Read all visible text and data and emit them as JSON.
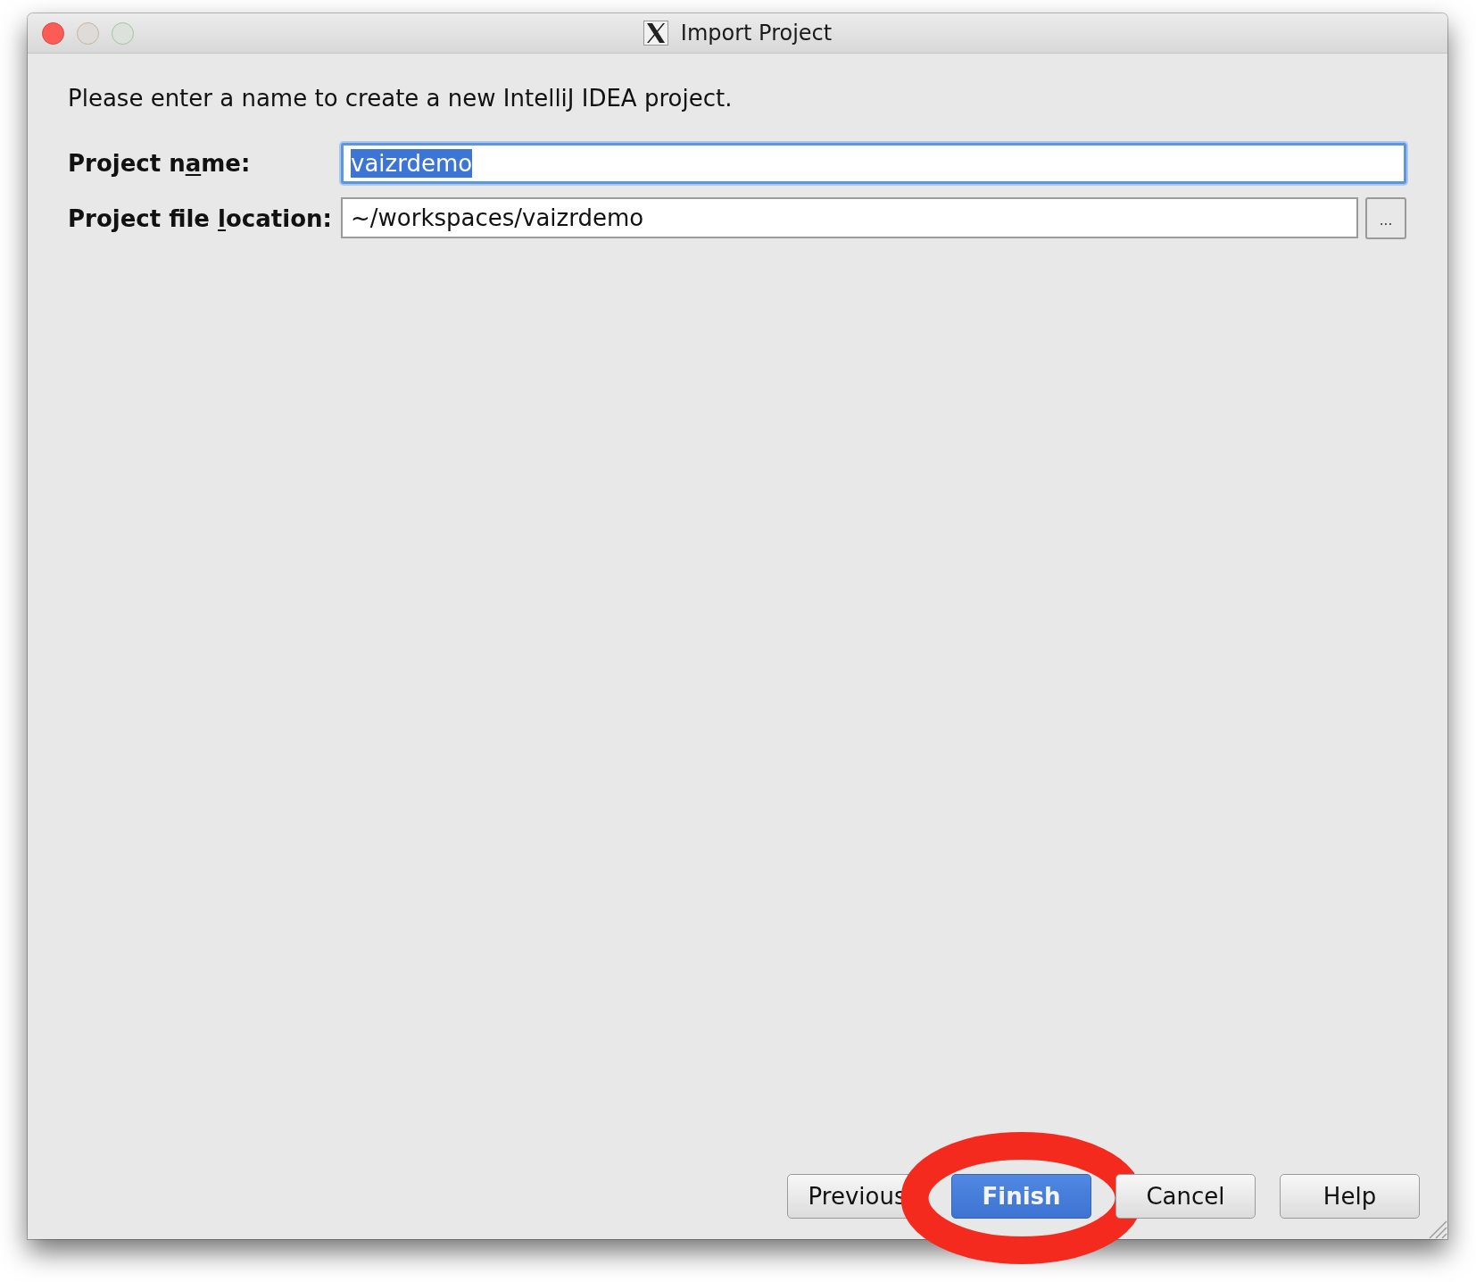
{
  "window": {
    "title": "Import Project",
    "controls": [
      {
        "kind": "close",
        "enabled": true
      },
      {
        "kind": "minimize",
        "enabled": false
      },
      {
        "kind": "zoom",
        "enabled": false
      }
    ]
  },
  "instruction": "Please enter a name to create a new IntelliJ IDEA project.",
  "fields": [
    {
      "label": {
        "before": "Project n",
        "mnemonic": "a",
        "after": "me:"
      },
      "value": "vaizrdemo",
      "focused": true,
      "text_selected": true
    },
    {
      "label": {
        "before": "Project file ",
        "mnemonic": "l",
        "after": "ocation:"
      },
      "value": "~/workspaces/vaizrdemo",
      "focused": false,
      "text_selected": false,
      "browse_button": "..."
    }
  ],
  "buttons": [
    {
      "label": "Previous",
      "default": false,
      "highlighted": false
    },
    {
      "label": "Finish",
      "default": true,
      "highlighted": true
    },
    {
      "label": "Cancel",
      "default": false,
      "highlighted": false
    },
    {
      "label": "Help",
      "default": false,
      "highlighted": false
    }
  ]
}
